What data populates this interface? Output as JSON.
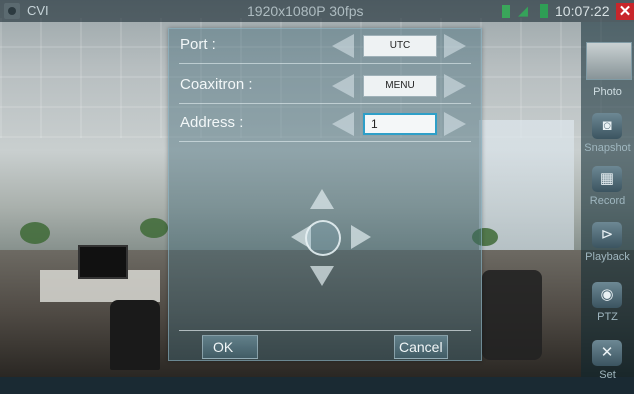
{
  "statusbar": {
    "app_name": "CVI",
    "resolution": "1920x1080P 30fps",
    "time": "10:07:22",
    "close_glyph": "✕"
  },
  "sidebar": {
    "items": [
      {
        "label": "Photo",
        "icon": "photo-icon"
      },
      {
        "label": "Snapshot",
        "icon": "camera-icon",
        "glyph": "◙"
      },
      {
        "label": "Record",
        "icon": "record-icon",
        "glyph": "▦"
      },
      {
        "label": "Playback",
        "icon": "playback-icon",
        "glyph": "⊳"
      },
      {
        "label": "PTZ",
        "icon": "ptz-icon",
        "glyph": "◉"
      },
      {
        "label": "Set",
        "icon": "settings-icon",
        "glyph": "✕"
      }
    ]
  },
  "dialog": {
    "port": {
      "label": "Port :",
      "value": "UTC"
    },
    "coaxitron": {
      "label": "Coaxitron :",
      "value": "MENU"
    },
    "address": {
      "label": "Address :",
      "value": "1"
    },
    "ok_label": "OK",
    "cancel_label": "Cancel"
  },
  "colors": {
    "accent": "#2e9fc8",
    "close": "#c8262b",
    "status_green": "#36a25a"
  }
}
